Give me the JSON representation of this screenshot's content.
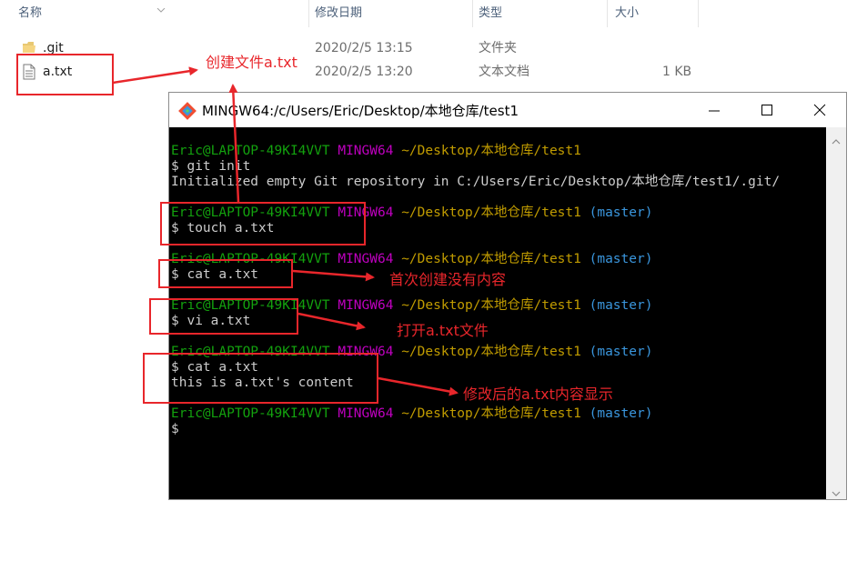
{
  "explorer": {
    "columns": {
      "name": "名称",
      "modified": "修改日期",
      "type": "类型",
      "size": "大小"
    },
    "rows": [
      {
        "name": ".git",
        "modified": "2020/2/5 13:15",
        "type": "文件夹",
        "size": "",
        "icon": "folder-icon"
      },
      {
        "name": "a.txt",
        "modified": "2020/2/5 13:20",
        "type": "文本文档",
        "size": "1 KB",
        "icon": "text-file-icon"
      }
    ]
  },
  "terminal": {
    "title": "MINGW64:/c/Users/Eric/Desktop/本地仓库/test1",
    "lines": [
      {
        "user": "Eric@LAPTOP-49KI4VVT",
        "env": "MINGW64",
        "path": "~/Desktop/本地仓库/test1",
        "branch": ""
      },
      {
        "text": "$ git init"
      },
      {
        "text": "Initialized empty Git repository in C:/Users/Eric/Desktop/本地仓库/test1/.git/"
      },
      {
        "user": "Eric@LAPTOP-49KI4VVT",
        "env": "MINGW64",
        "path": "~/Desktop/本地仓库/test1",
        "branch": "(master)"
      },
      {
        "text": "$ touch a.txt"
      },
      {
        "user": "Eric@LAPTOP-49KI4VVT",
        "env": "MINGW64",
        "path": "~/Desktop/本地仓库/test1",
        "branch": "(master)"
      },
      {
        "text": "$ cat a.txt"
      },
      {
        "user": "Eric@LAPTOP-49KI4VVT",
        "env": "MINGW64",
        "path": "~/Desktop/本地仓库/test1",
        "branch": "(master)"
      },
      {
        "text": "$ vi a.txt"
      },
      {
        "user": "Eric@LAPTOP-49KI4VVT",
        "env": "MINGW64",
        "path": "~/Desktop/本地仓库/test1",
        "branch": "(master)"
      },
      {
        "text": "$ cat a.txt"
      },
      {
        "text": "this is a.txt's content"
      },
      {
        "user": "Eric@LAPTOP-49KI4VVT",
        "env": "MINGW64",
        "path": "~/Desktop/本地仓库/test1",
        "branch": "(master)"
      },
      {
        "text": "$"
      }
    ]
  },
  "annotations": {
    "create_file": "创建文件a.txt",
    "first_create_empty": "首次创建没有内容",
    "open_file": "打开a.txt文件",
    "modified_display": "修改后的a.txt内容显示"
  },
  "colors": {
    "annotation": "#e8262b",
    "prompt_user": "#13a10e",
    "prompt_env": "#bf00bf",
    "prompt_path": "#c19c00",
    "prompt_branch": "#3a96dd",
    "terminal_bg": "#000000"
  }
}
